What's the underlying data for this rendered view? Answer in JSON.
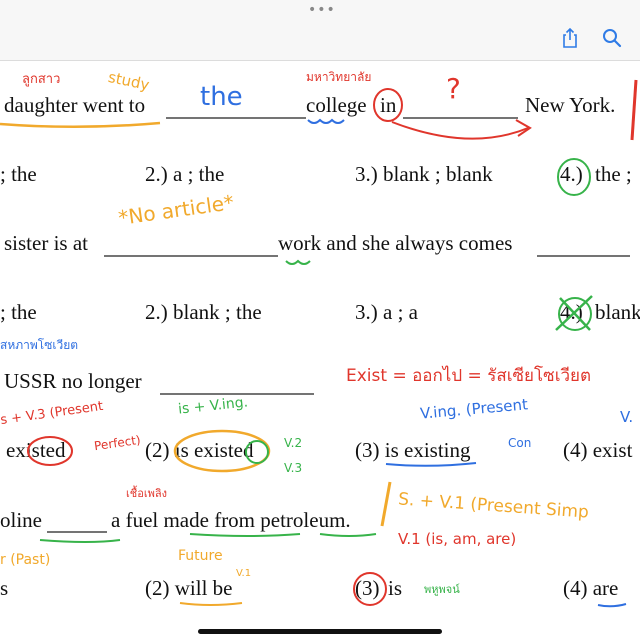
{
  "toolbar": {
    "more_dots": "•••",
    "share_icon": "share-icon",
    "search_icon": "search-icon"
  },
  "q1": {
    "text_a": "daughter went to",
    "text_b": "college",
    "text_in": "in",
    "text_c": "New York.",
    "opt1": "; the",
    "opt2": "2.) a ; the",
    "opt3": "3.) blank ; blank",
    "opt4_num": "4.)",
    "opt4_rest": "the ;",
    "note_the": "the",
    "note_top_left": "ลูกสาว",
    "note_study": "study",
    "note_university": "มหาวิทยาลัย",
    "note_question": "?"
  },
  "q2": {
    "text_a": "sister is at",
    "text_b": "work and she always comes",
    "opt1": "; the",
    "opt2": "2.) blank ; the",
    "opt3": "3.) a ; a",
    "opt4_num": "4.)",
    "opt4_rest": "blank",
    "note_no_article": "*No article*"
  },
  "q3": {
    "text_a": "USSR no longer",
    "opt1_rest": "existed",
    "opt2": "(2) is existed",
    "opt3": "(3) is existing",
    "opt4": "(4) exist",
    "note_thai": "สหภาพโซเวียต",
    "note_exist": "Exist = ออกไป = รัสเซียโซเวียต",
    "note_present_perfect_a": "s + V.3 (Present",
    "note_present_perfect_b": "Perfect)",
    "note_is_ving": "is + V.ing.",
    "note_v2": "V.2",
    "note_v3": "V.3",
    "note_ving_present": "V.ing. (Present",
    "note_con": "Con",
    "note_edge": "V."
  },
  "q4": {
    "text_a": "oline",
    "text_b": "a fuel made from petroleum.",
    "opt1": "s",
    "opt2": "(2) will be",
    "opt3_num": "(3)",
    "opt3_rest": "is",
    "opt4": "(4) are",
    "note_past": "r (Past)",
    "note_future": "Future",
    "note_v1_small": "V.1",
    "note_thai": "เชื้อเพลิง",
    "note_present_simple": "S. + V.1 (Present Simp",
    "note_v1_is": "V.1 (is, am, are)",
    "note_plural": "พหูพจน์"
  }
}
